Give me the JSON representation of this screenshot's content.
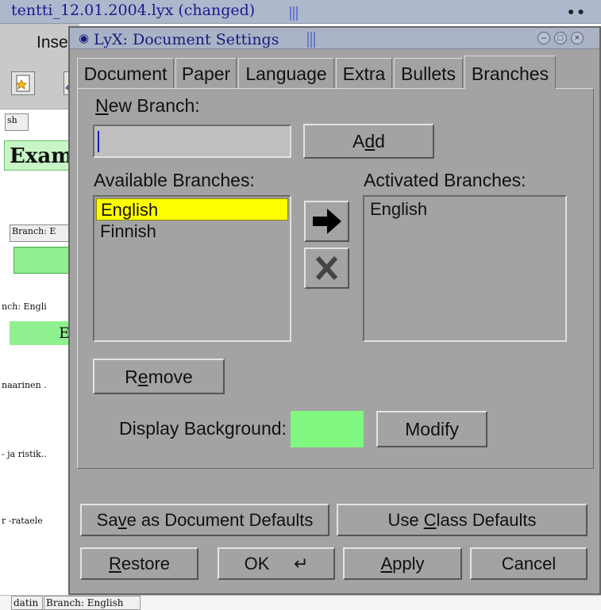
{
  "background_window": {
    "title": "tentti_12.01.2004.lyx (changed)",
    "menu_item": "Inse",
    "doc_labels": [
      "sh",
      "Exam",
      "Branch: E",
      "nch: Engli",
      "E",
      "naarinen .",
      "- ja ristik..",
      "r -rataele"
    ],
    "status_cells": [
      "datin",
      "Branch: English"
    ]
  },
  "dialog": {
    "title": "LyX: Document Settings",
    "tabs": [
      "Document",
      "Paper",
      "Language",
      "Extra",
      "Bullets",
      "Branches"
    ],
    "active_tab": "Branches",
    "new_branch": {
      "label_pre": "",
      "label_mnemonic": "N",
      "label_post": "ew Branch:",
      "value": ""
    },
    "add_button": {
      "pre": "A",
      "mnemonic": "d",
      "post": "d"
    },
    "available": {
      "label": "Available Branches:",
      "items": [
        "English",
        "Finnish"
      ],
      "selected": "English"
    },
    "activated": {
      "label": "Activated Branches:",
      "items": [
        "English"
      ]
    },
    "activate_icon": "right-arrow-icon",
    "deactivate_icon": "x-icon",
    "remove_button": {
      "pre": "R",
      "mnemonic": "e",
      "post": "move"
    },
    "display_background_label": "Display Background:",
    "background_color": "#80f880",
    "modify_button": "Modify",
    "save_defaults_button": {
      "pre": "Sa",
      "mnemonic": "v",
      "post": "e as Document Defaults"
    },
    "class_defaults_button": {
      "pre": "Use ",
      "mnemonic": "C",
      "post": "lass Defaults"
    },
    "restore_button": {
      "pre": "",
      "mnemonic": "R",
      "post": "estore"
    },
    "ok_button": "OK",
    "apply_button": {
      "pre": "",
      "mnemonic": "A",
      "post": "pply"
    },
    "cancel_button": "Cancel"
  },
  "colors": {
    "dialog_bg": "#a3a3a3",
    "selection": "#ffff00",
    "title_text": "#1a1a7a"
  }
}
